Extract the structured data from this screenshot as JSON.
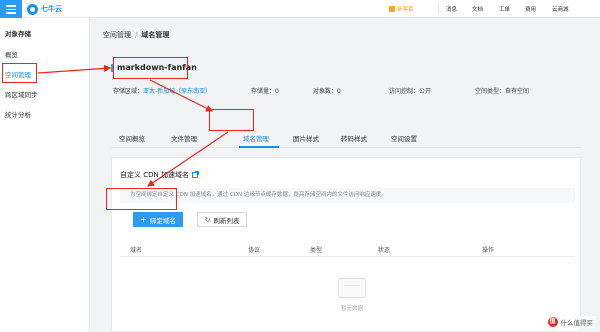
{
  "topbar": {
    "logo_text": "七牛云",
    "nav": {
      "promo": "新客套",
      "messages": "消息",
      "docs": "文档",
      "tickets": "工单",
      "billing": "费用",
      "marketplace": "云商城"
    }
  },
  "sidebar": {
    "title": "对象存储",
    "items": [
      {
        "label": "概览",
        "active": false
      },
      {
        "label": "空间管理",
        "active": true
      },
      {
        "label": "跨区域同步",
        "active": false
      },
      {
        "label": "统计分析",
        "active": false
      }
    ]
  },
  "breadcrumb": {
    "parent": "空间管理",
    "separator": "/",
    "current": "域名管理"
  },
  "bucket": {
    "name": "markdown-fanfan",
    "info": {
      "region_label": "存储区域：",
      "region_value": "亚太-新加坡（原东南亚）",
      "storage_label": "存储量：",
      "storage_value": "0",
      "objects_label": "对象数：",
      "objects_value": "0",
      "access_label": "访问控制：",
      "access_value": "公开",
      "type_label": "空间类型：",
      "type_value": "自有空间"
    }
  },
  "tabs": [
    {
      "label": "空间概览",
      "active": false
    },
    {
      "label": "文件管理",
      "active": false
    },
    {
      "label": "域名管理",
      "active": true
    },
    {
      "label": "图片样式",
      "active": false
    },
    {
      "label": "转码样式",
      "active": false
    },
    {
      "label": "空间设置",
      "active": false
    }
  ],
  "panel": {
    "title": "自定义 CDN 加速域名",
    "description": "为空间绑定自定义 CDN 加速域名，通过 CDN 边缘节点缓存数据，提高存储空间内的文件访问响应速度。",
    "bind_button": "绑定域名",
    "refresh_button": "刷新列表",
    "table_headers": [
      "域名",
      "协议",
      "类型",
      "状态",
      "操作"
    ],
    "empty_text": "暂无数据"
  },
  "watermark": {
    "badge": "值",
    "text": "什么值得买"
  },
  "colors": {
    "accent": "#1a8fe6",
    "annotation_red": "#e8281e",
    "promo_orange": "#f5a623"
  },
  "icons": {
    "menu": "hamburger-icon",
    "external_link": "external-link-icon",
    "refresh": "refresh-icon",
    "plus": "plus-icon",
    "empty_state": "empty-box-icon"
  }
}
